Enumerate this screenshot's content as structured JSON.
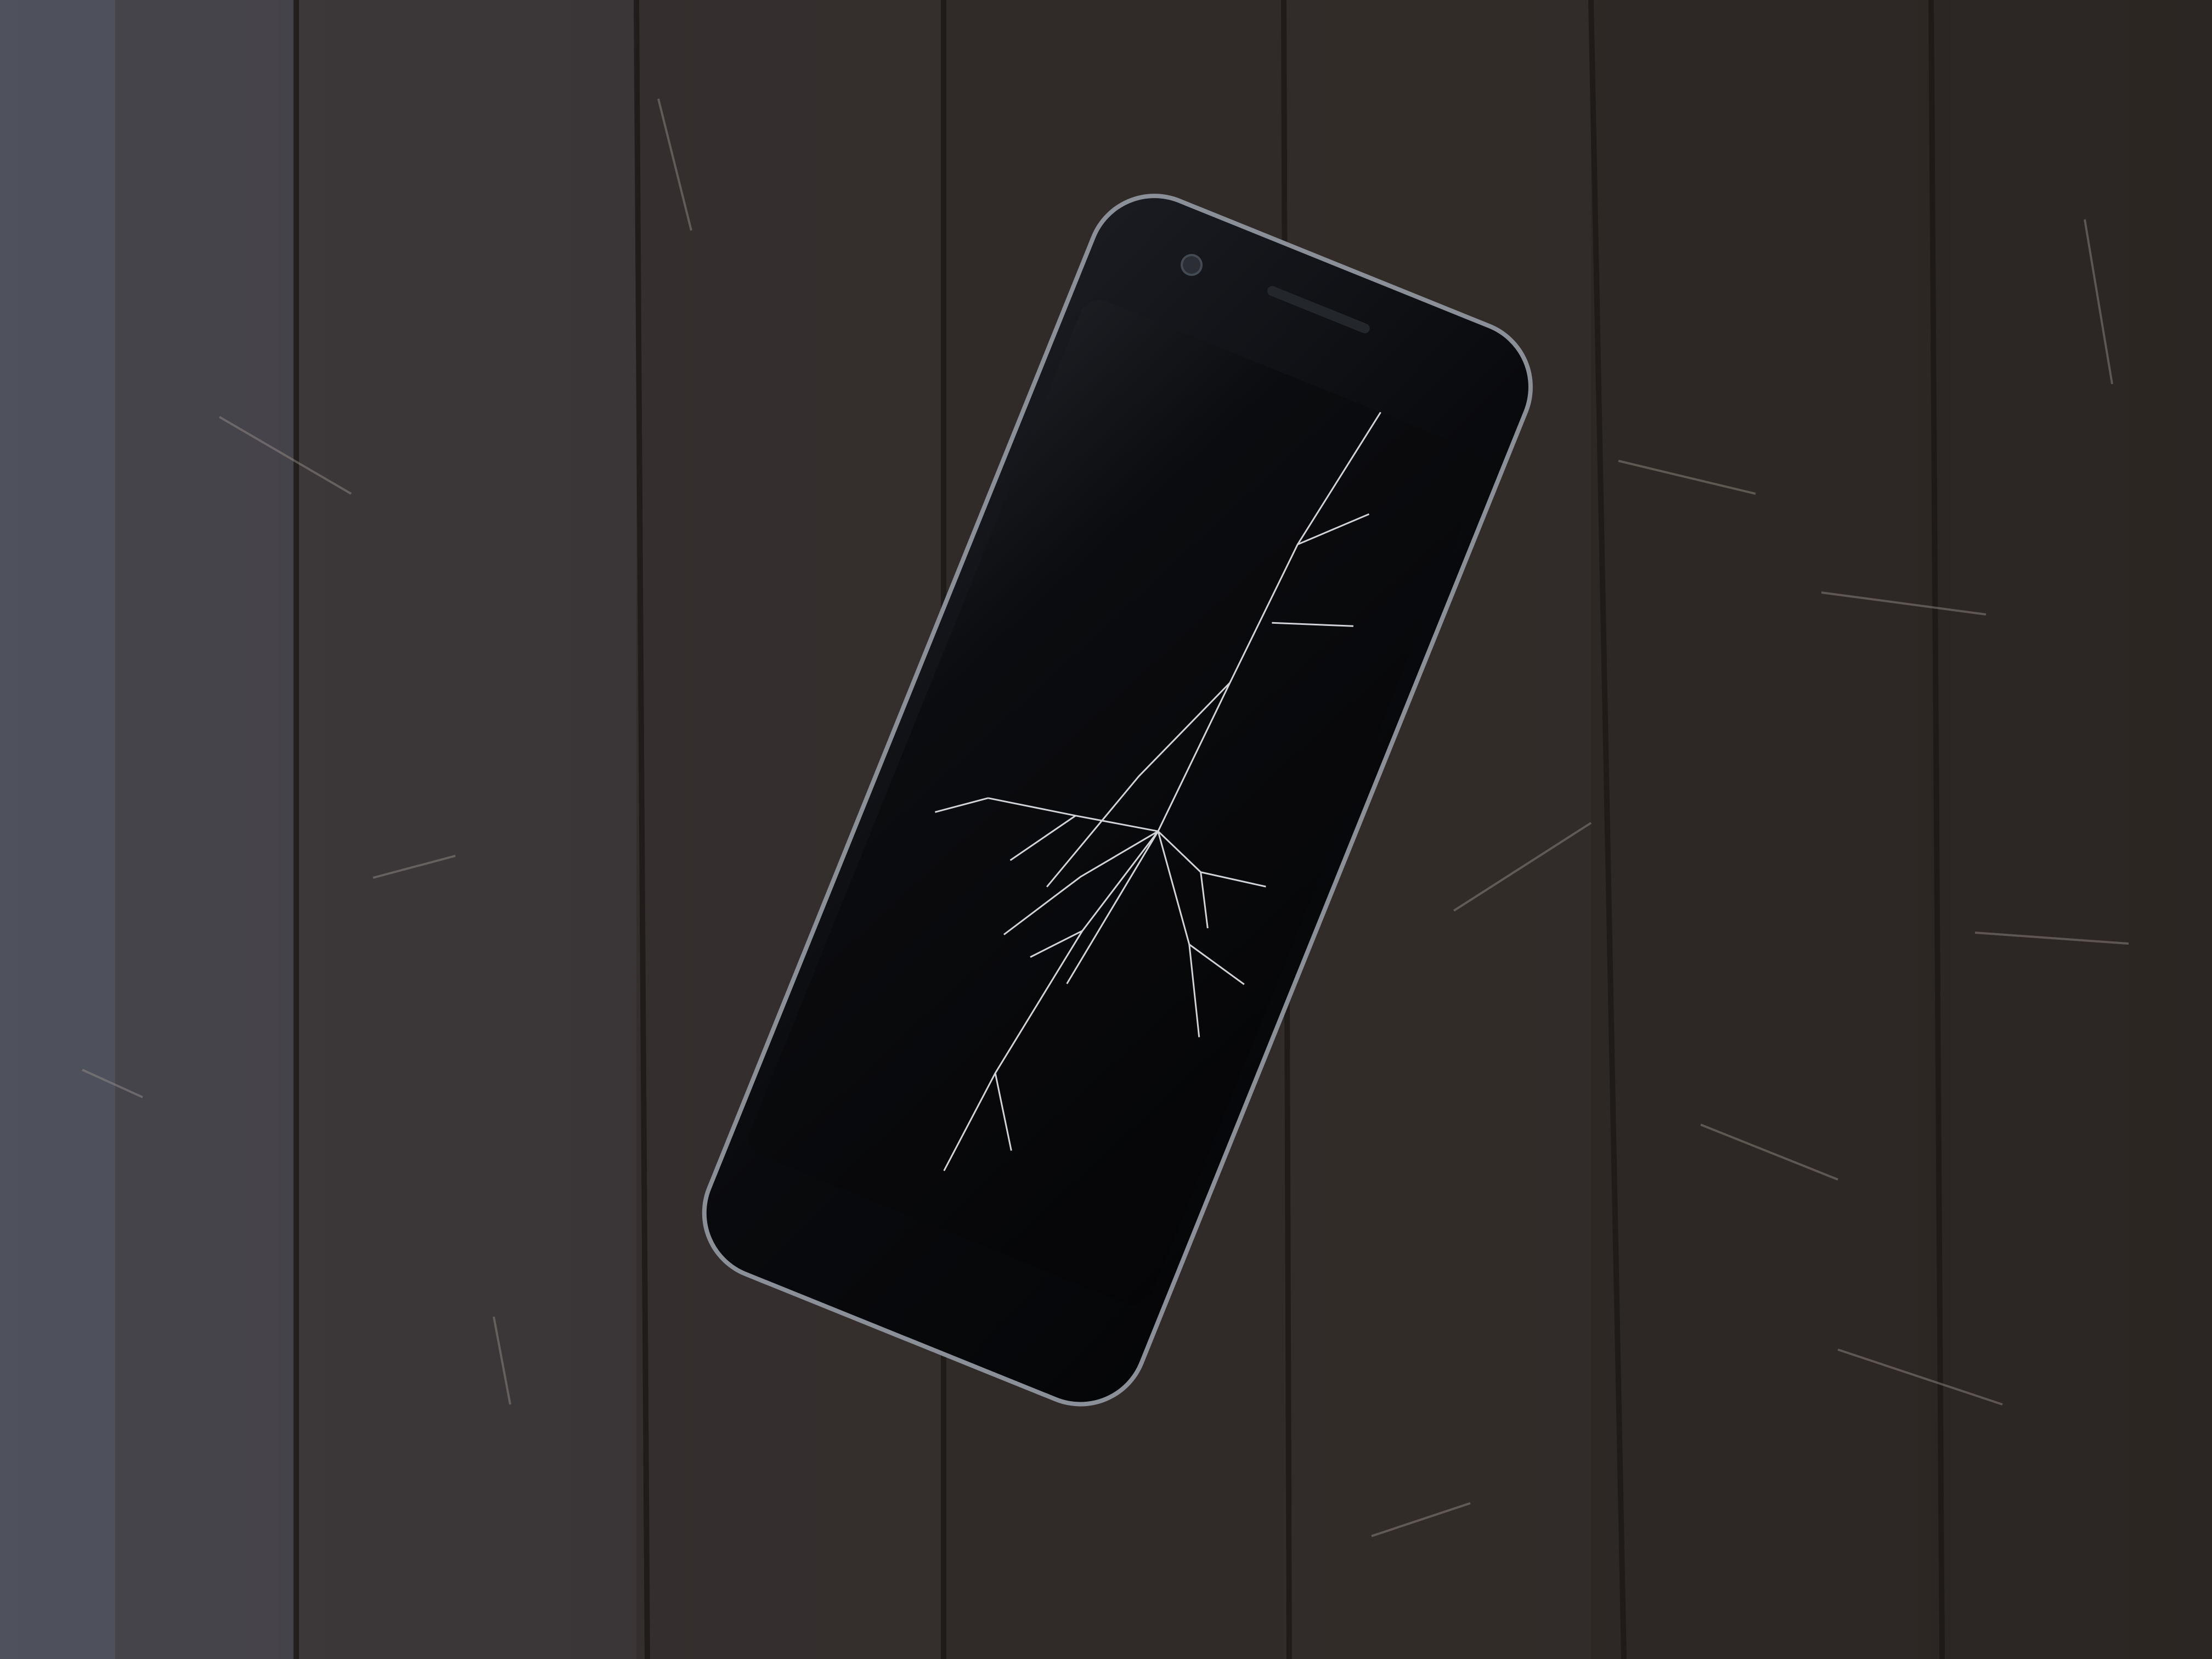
{
  "scene": {
    "subject": "smartphone",
    "surface": "wooden-table",
    "screen_state": "off",
    "screen_condition": "cracked"
  },
  "colors": {
    "wood_dark": "#2a2522",
    "wood_mid": "#3a3430",
    "wood_light": "#4d4744",
    "wood_left_light": "#595863",
    "phone_body": "#08090c",
    "phone_screen": "#050608",
    "phone_edge_highlight": "#8b8f98",
    "crack": "#e6e9ee",
    "scratch": "#9b938c"
  },
  "icons": {
    "camera": "front-camera-icon",
    "speaker": "earpiece-speaker-icon"
  }
}
